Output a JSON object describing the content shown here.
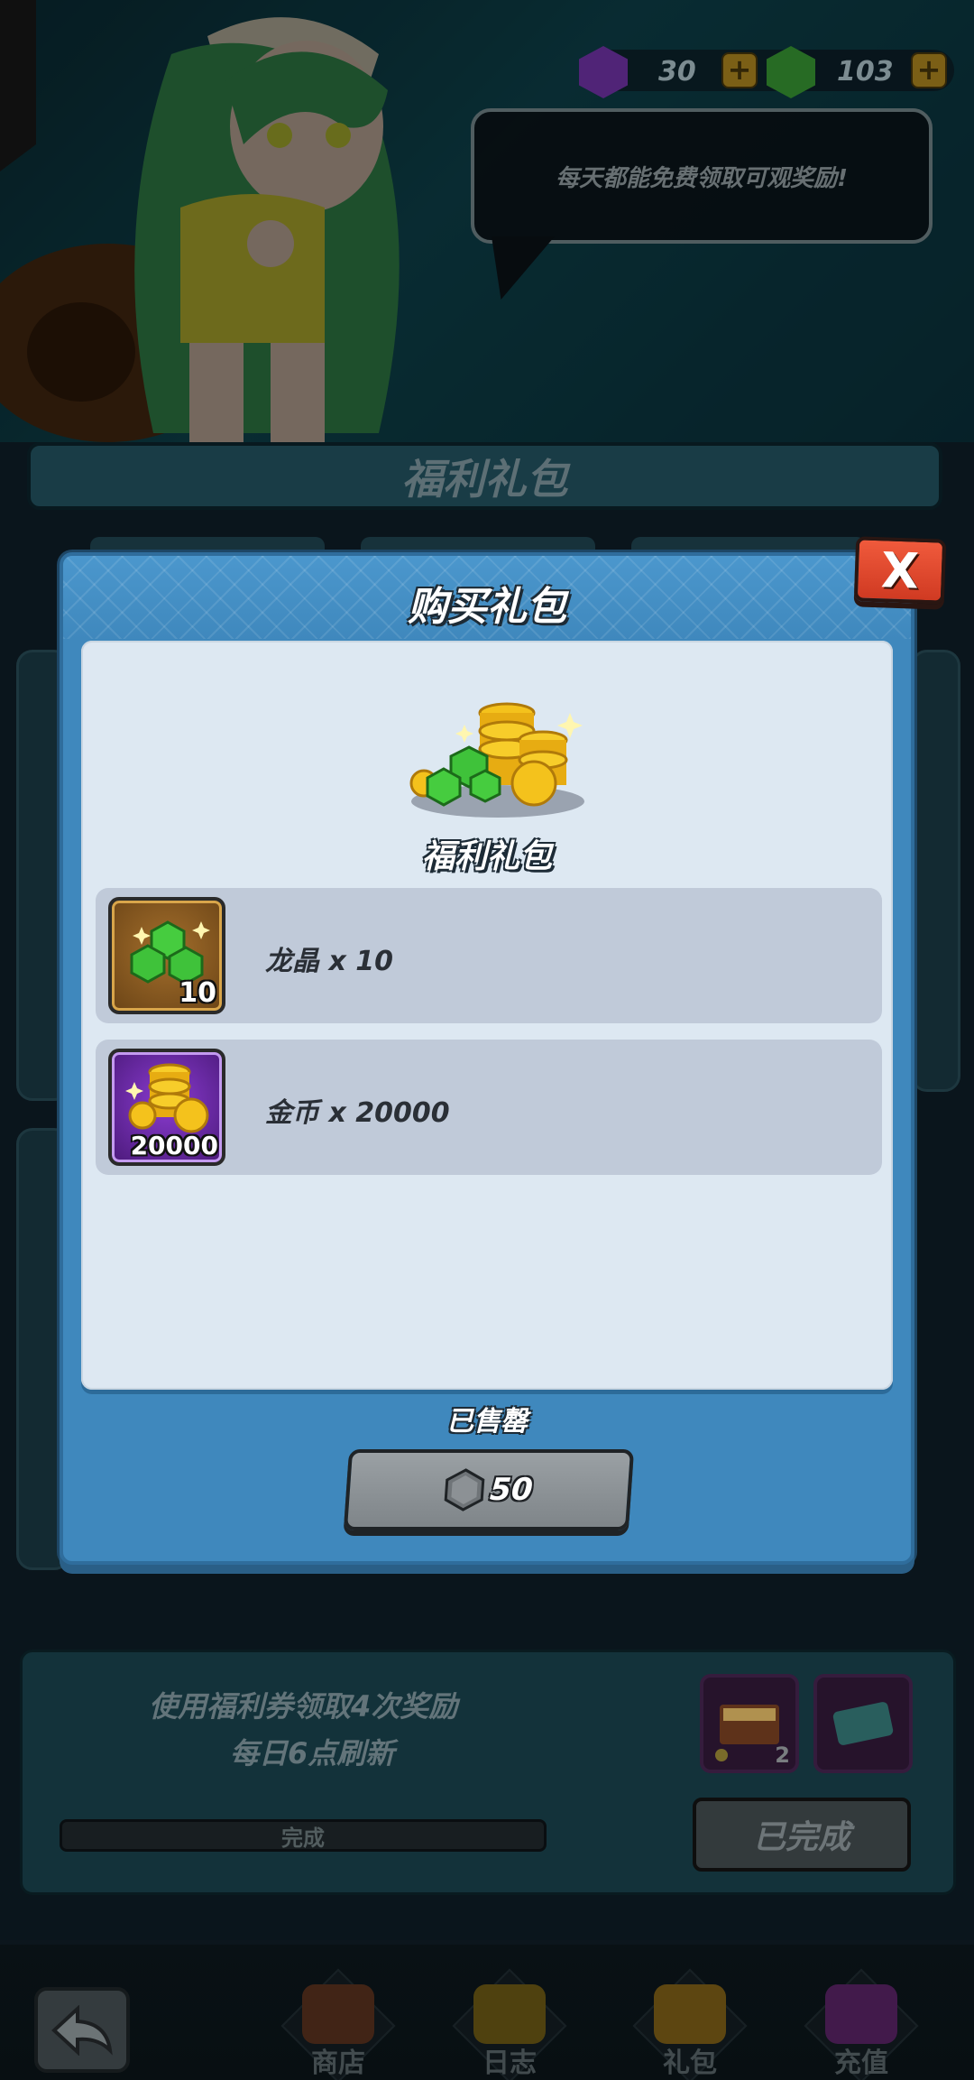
{
  "currency": {
    "purple_gem": {
      "amount": "30",
      "icon": "purple-gem-icon",
      "color": "#8b3fd4"
    },
    "green_gem": {
      "amount": "103",
      "icon": "green-gem-icon",
      "color": "#3fbf3a"
    }
  },
  "speech_bubble": {
    "text": "每天都能免费领取可观奖励!"
  },
  "section_banner": {
    "title": "福利礼包"
  },
  "modal": {
    "title": "购买礼包",
    "close_label": "X",
    "gift_name": "福利礼包",
    "rewards": [
      {
        "label": "龙晶 x 10",
        "count": "10",
        "icon": "green-crystal-icon"
      },
      {
        "label": "金币 x 20000",
        "count": "20000",
        "icon": "gold-coin-icon"
      }
    ],
    "status_label": "已售罄",
    "price": {
      "value": "50",
      "icon": "gray-gem-icon"
    }
  },
  "quest": {
    "line1": "使用福利券领取4次奖励",
    "line2": "每日6点刷新",
    "progress_label": "完成",
    "button_label": "已完成",
    "reward_count": "2"
  },
  "bottom_nav": {
    "items": [
      {
        "label": "商店",
        "icon": "shop-icon"
      },
      {
        "label": "日志",
        "icon": "journal-icon"
      },
      {
        "label": "礼包",
        "icon": "chest-icon"
      },
      {
        "label": "充值",
        "icon": "recharge-icon"
      }
    ]
  },
  "colors": {
    "modal_blue": "#3f88bd",
    "content_panel": "#dde8f2",
    "reward_row": "#c0cad9",
    "close_red": "#e04a30",
    "price_gray": "#8a9094"
  }
}
